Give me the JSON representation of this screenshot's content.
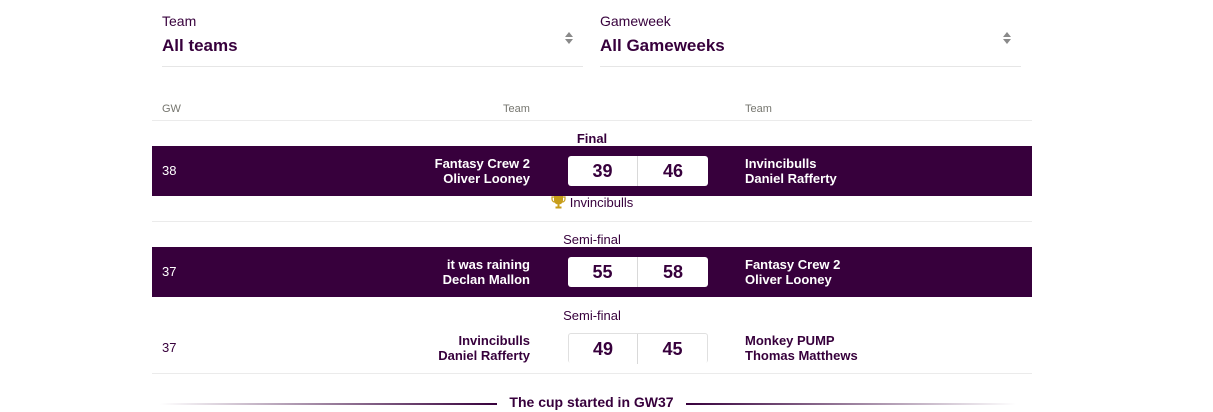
{
  "filters": {
    "team": {
      "label": "Team",
      "value": "All teams"
    },
    "gameweek": {
      "label": "Gameweek",
      "value": "All Gameweeks"
    }
  },
  "columns": {
    "gw": "GW",
    "team_home": "Team",
    "team_away": "Team"
  },
  "rounds": [
    {
      "title": "Final",
      "gw": "38",
      "home": {
        "team": "Fantasy Crew 2",
        "manager": "Oliver Looney",
        "score": "39"
      },
      "away": {
        "team": "Invincibulls",
        "manager": "Daniel Rafferty",
        "score": "46"
      },
      "winner": "Invincibulls"
    },
    {
      "title": "Semi-final",
      "gw": "37",
      "home": {
        "team": "it was raining",
        "manager": "Declan Mallon",
        "score": "55"
      },
      "away": {
        "team": "Fantasy Crew 2",
        "manager": "Oliver Looney",
        "score": "58"
      }
    },
    {
      "title": "Semi-final",
      "gw": "37",
      "home": {
        "team": "Invincibulls",
        "manager": "Daniel Rafferty",
        "score": "49"
      },
      "away": {
        "team": "Monkey PUMP",
        "manager": "Thomas Matthews",
        "score": "45"
      }
    }
  ],
  "footer": {
    "text": "The cup started in GW37"
  },
  "colors": {
    "primary": "#37003c",
    "trophy": "#c79d1a"
  },
  "icons": {
    "sort": "sort-arrows-icon",
    "trophy": "trophy-icon"
  }
}
